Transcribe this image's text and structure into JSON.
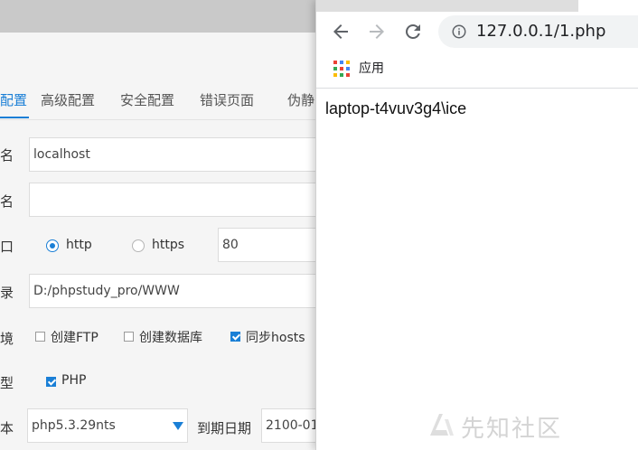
{
  "phpstudy": {
    "tabs": [
      {
        "label": "配置",
        "active": true
      },
      {
        "label": "高级配置"
      },
      {
        "label": "安全配置"
      },
      {
        "label": "错误页面"
      },
      {
        "label": "伪静"
      }
    ],
    "rows": {
      "domain": {
        "label": "域名",
        "value": "localhost"
      },
      "second_domain": {
        "label": "域名",
        "value": ""
      },
      "port": {
        "label": "端口",
        "options": [
          {
            "label": "http",
            "selected": true
          },
          {
            "label": "https",
            "selected": false
          }
        ],
        "value": "80"
      },
      "root": {
        "label": "目录",
        "value": "D:/phpstudy_pro/WWW"
      },
      "env": {
        "label": "环境",
        "checks": [
          {
            "label": "创建FTP",
            "checked": false
          },
          {
            "label": "创建数据库",
            "checked": false
          },
          {
            "label": "同步hosts",
            "checked": true
          }
        ]
      },
      "type": {
        "label": "类型",
        "checks": [
          {
            "label": "PHP",
            "checked": true
          }
        ]
      },
      "version": {
        "label": "版本",
        "value": "php5.3.29nts",
        "expire_label": "到期日期",
        "expire_value": "2100-01"
      }
    },
    "colors": {
      "accent": "#1a7fd6"
    }
  },
  "browser": {
    "url": "127.0.0.1/1.php",
    "bookmarks": [
      {
        "label": "应用",
        "icon": "apps-grid-icon"
      }
    ],
    "page_text": "laptop-t4vuv3g4\\ice",
    "watermark": "先知社区"
  }
}
